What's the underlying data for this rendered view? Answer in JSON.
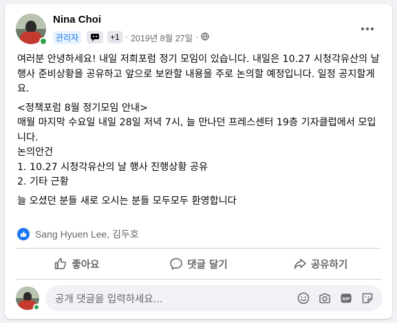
{
  "post": {
    "author": "Nina Choi",
    "role_badge": "관리자",
    "plus_badge": "+1",
    "separator": "·",
    "timestamp": "2019년 8월 27일",
    "privacy_icon": "globe-icon",
    "body_lines": [
      "여러분 안녕하세요! 내일 저희포럼 정기 모임이 있습니다. 내일은 10.27 시청각유산의 날 행사 준비상황을 공유하고 앞으로 보완할 내용을 주로 논의할 예정입니다. 일정 공지할게요."
    ],
    "notice_lines": [
      "<정책포럼 8월 정기모임 안내>",
      "매월 마지막 수요일 내일 28일 저녁 7시, 늘 만나던 프레스센터 19층 기자클럽에서 모입니다.",
      "논의안건",
      "1. 10.27 시청각유산의 날 행사 진행상황 공유",
      "2. 기타 근황"
    ],
    "closing": "늘 오셨던 분들 새로 오시는 분들 모두모두 환영합니다"
  },
  "reactions": {
    "names": "Sang Hyuen Lee, 김두호",
    "icon": "like-reaction-icon"
  },
  "actions": {
    "like": "좋아요",
    "comment": "댓글 달기",
    "share": "공유하기"
  },
  "comment_box": {
    "placeholder": "공개 댓글을 입력하세요..."
  },
  "colors": {
    "accent": "#1877f2",
    "muted_text": "#65676b",
    "background": "#f0f2f5",
    "online": "#31a24c"
  }
}
